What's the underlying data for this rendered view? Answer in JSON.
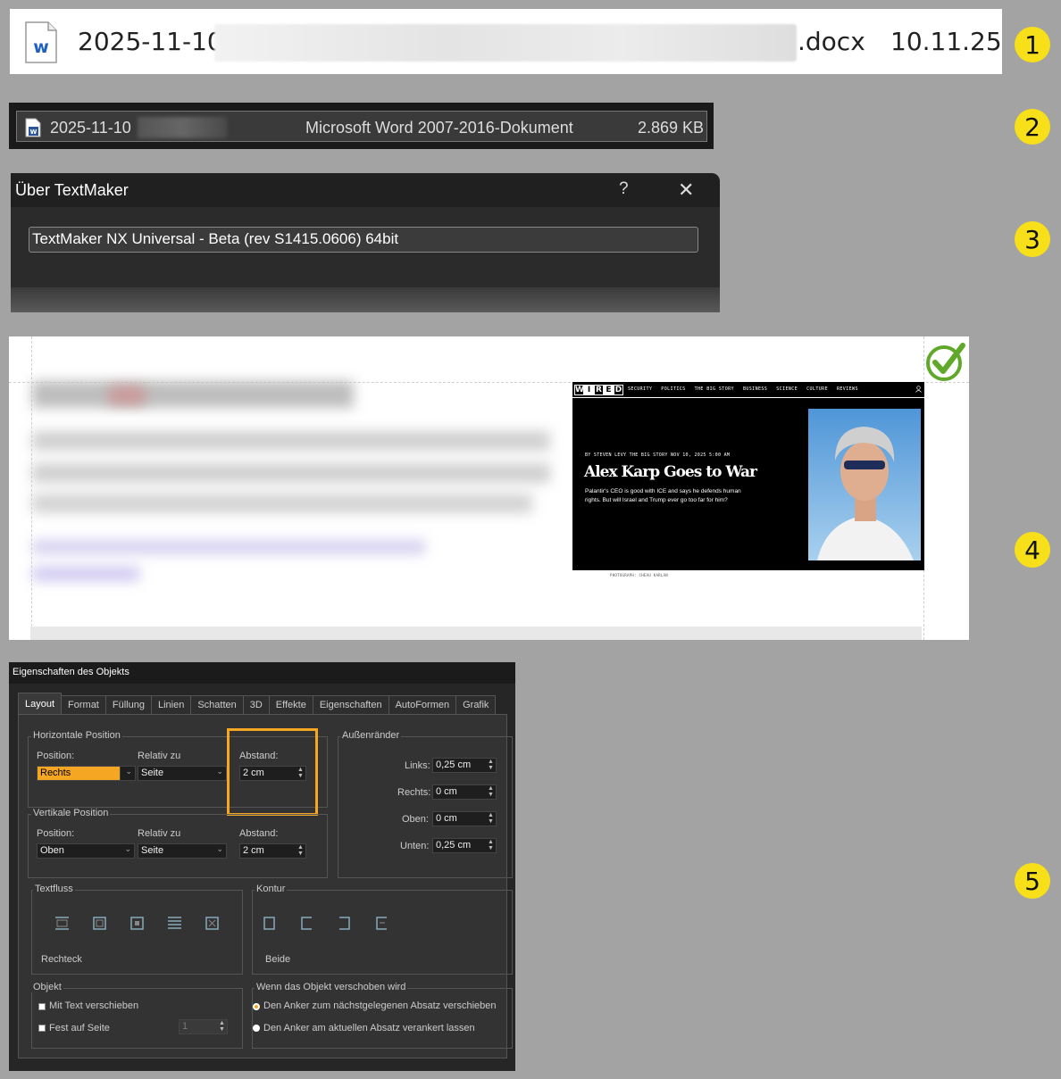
{
  "badges": [
    "1",
    "2",
    "3",
    "4",
    "5"
  ],
  "panel1": {
    "name_prefix": "2025-11-10",
    "ext": ".docx",
    "date": "10.11.25",
    "icon": "word-doc-icon"
  },
  "panel2": {
    "name_prefix": "2025-11-10",
    "type": "Microsoft Word 2007-2016-Dokument",
    "size": "2.869 KB",
    "icon": "word-file-icon"
  },
  "panel3": {
    "title": "Über TextMaker",
    "help": "?",
    "close": "✕",
    "version": "TextMaker NX Universal - Beta (rev S1415.0606) 64bit"
  },
  "panel4": {
    "wired": {
      "nav": [
        "SECURITY",
        "POLITICS",
        "THE BIG STORY",
        "BUSINESS",
        "SCIENCE",
        "CULTURE",
        "REVIEWS"
      ],
      "byline": "BY STEVEN LEVY   THE BIG STORY   NOV 10, 2025 5:00 AM",
      "headline": "Alex Karp Goes to War",
      "dek": "Palantir's CEO is good with ICE and says he defends human rights. But will Israel and Trump ever go too far for him?",
      "credit": "PHOTOGRAPH: CHEAU KARLAN"
    }
  },
  "panel5": {
    "window_title": "Eigenschaften des Objekts",
    "tabs": [
      "Layout",
      "Format",
      "Füllung",
      "Linien",
      "Schatten",
      "3D",
      "Effekte",
      "Eigenschaften",
      "AutoFormen",
      "Grafik"
    ],
    "horizontal": {
      "group": "Horizontale Position",
      "position_label": "Position:",
      "position_value": "Rechts",
      "relativ_label": "Relativ zu",
      "relativ_value": "Seite",
      "abstand_label": "Abstand:",
      "abstand_value": "2 cm"
    },
    "vertical": {
      "group": "Vertikale Position",
      "position_label": "Position:",
      "position_value": "Oben",
      "relativ_label": "Relativ zu",
      "relativ_value": "Seite",
      "abstand_label": "Abstand:",
      "abstand_value": "2 cm"
    },
    "margins": {
      "group": "Außenränder",
      "links_label": "Links:",
      "links_value": "0,25 cm",
      "rechts_label": "Rechts:",
      "rechts_value": "0 cm",
      "oben_label": "Oben:",
      "oben_value": "0 cm",
      "unten_label": "Unten:",
      "unten_value": "0,25 cm"
    },
    "textfluss": {
      "group": "Textfluss",
      "value": "Rechteck"
    },
    "kontur": {
      "group": "Kontur",
      "value": "Beide"
    },
    "objekt": {
      "group": "Objekt",
      "move_with_text": "Mit Text verschieben",
      "fix_on_page": "Fest auf Seite",
      "page_value": "1"
    },
    "anchor": {
      "group": "Wenn das Objekt verschoben wird",
      "option1": "Den Anker zum nächstgelegenen Absatz verschieben",
      "option2": "Den Anker am aktuellen Absatz verankert lassen"
    },
    "accent": "#f5a623"
  }
}
